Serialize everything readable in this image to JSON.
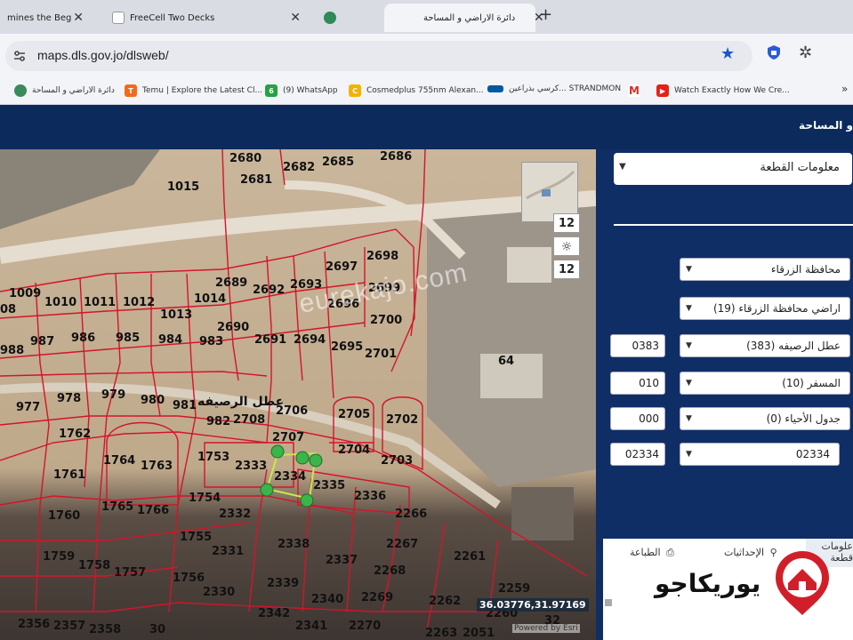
{
  "browser": {
    "tabs": [
      {
        "label": "mines the Beginn...",
        "active": false
      },
      {
        "label": "FreeCell Two Decks",
        "active": false
      },
      {
        "label": "",
        "active": false
      },
      {
        "label": "دائرة الاراضي و المساحة",
        "active": true
      }
    ],
    "new_tab": "+",
    "url": "maps.dls.gov.jo/dlsweb/",
    "bookmarks": [
      {
        "label": "دائرة الاراضي و المساحة",
        "icon": "dls-icon"
      },
      {
        "label": "Temu | Explore the Latest Cl...",
        "icon": "temu-icon"
      },
      {
        "label": "(9) WhatsApp",
        "icon": "whatsapp-icon"
      },
      {
        "label": "Cosmedplus 755nm Alexan...",
        "icon": "cosmed-icon"
      },
      {
        "label": "كرسي بذراعين... STRANDMON",
        "icon": "ikea-icon"
      },
      {
        "label": "",
        "icon": "gmail-icon"
      },
      {
        "label": "Watch Exactly How We Cre...",
        "icon": "youtube-icon"
      }
    ],
    "more": "»"
  },
  "app": {
    "title": "و المساحة"
  },
  "map": {
    "watermark": "eurekajo.com",
    "coords": "36.03776,31.97169",
    "attribution": "Powered by Esri",
    "overview_zoom_top": "12",
    "overview_zoom_bottom": "12",
    "area_label": "عطل الرصيفه",
    "parcels": [
      {
        "id": "2680"
      },
      {
        "id": "2682"
      },
      {
        "id": "2685"
      },
      {
        "id": "2686"
      },
      {
        "id": "2681"
      },
      {
        "id": "1015"
      },
      {
        "id": "2698"
      },
      {
        "id": "2697"
      },
      {
        "id": "2699"
      },
      {
        "id": "2689"
      },
      {
        "id": "2692"
      },
      {
        "id": "2693"
      },
      {
        "id": "2696"
      },
      {
        "id": "1009"
      },
      {
        "id": "1010"
      },
      {
        "id": "1011"
      },
      {
        "id": "1012"
      },
      {
        "id": "1014"
      },
      {
        "id": "1013"
      },
      {
        "id": "2690"
      },
      {
        "id": "2700"
      },
      {
        "id": "987"
      },
      {
        "id": "986"
      },
      {
        "id": "985"
      },
      {
        "id": "984"
      },
      {
        "id": "983"
      },
      {
        "id": "2691"
      },
      {
        "id": "2694"
      },
      {
        "id": "2695"
      },
      {
        "id": "2701"
      },
      {
        "id": "988"
      },
      {
        "id": "08"
      },
      {
        "id": "64"
      },
      {
        "id": "979"
      },
      {
        "id": "978"
      },
      {
        "id": "980"
      },
      {
        "id": "981"
      },
      {
        "id": "977"
      },
      {
        "id": "982"
      },
      {
        "id": "2708"
      },
      {
        "id": "2706"
      },
      {
        "id": "2705"
      },
      {
        "id": "2702"
      },
      {
        "id": "1762"
      },
      {
        "id": "2707"
      },
      {
        "id": "2704"
      },
      {
        "id": "1764"
      },
      {
        "id": "1763"
      },
      {
        "id": "1753"
      },
      {
        "id": "2333"
      },
      {
        "id": "2703"
      },
      {
        "id": "1761"
      },
      {
        "id": "2334"
      },
      {
        "id": "2335"
      },
      {
        "id": "1754"
      },
      {
        "id": "2336"
      },
      {
        "id": "1765"
      },
      {
        "id": "1766"
      },
      {
        "id": "2332"
      },
      {
        "id": "1760"
      },
      {
        "id": "2266"
      },
      {
        "id": "1755"
      },
      {
        "id": "2338"
      },
      {
        "id": "2267"
      },
      {
        "id": "2331"
      },
      {
        "id": "1759"
      },
      {
        "id": "2337"
      },
      {
        "id": "2261"
      },
      {
        "id": "1758"
      },
      {
        "id": "1757"
      },
      {
        "id": "2268"
      },
      {
        "id": "1756"
      },
      {
        "id": "2339"
      },
      {
        "id": "2330"
      },
      {
        "id": "2259"
      },
      {
        "id": "2340"
      },
      {
        "id": "2269"
      },
      {
        "id": "2262"
      },
      {
        "id": "2260"
      },
      {
        "id": "2342"
      },
      {
        "id": "2356"
      },
      {
        "id": "2357"
      },
      {
        "id": "2358"
      },
      {
        "id": "2341"
      },
      {
        "id": "2270"
      },
      {
        "id": "2263"
      },
      {
        "id": "2051"
      },
      {
        "id": "32"
      },
      {
        "id": "30"
      }
    ]
  },
  "panel": {
    "header": "معلومات القطعة",
    "fields": [
      {
        "value": "محافظة الزرقاء",
        "code": ""
      },
      {
        "value": "اراضي محافظة الزرقاء (19)",
        "code": ""
      },
      {
        "value": "عطل الرصيفه (383)",
        "code": "0383"
      },
      {
        "value": "المسفر (10)",
        "code": "010"
      },
      {
        "value": "جدول الأحياء (0)",
        "code": "000"
      },
      {
        "value": "02334",
        "code": "02334"
      }
    ],
    "tabs": {
      "info": "علومات",
      "info2": "قطعة",
      "coordinates": "الإحداثيات",
      "print": "الطباعة"
    }
  },
  "brand": {
    "logo_text": "يوريكاجو"
  },
  "colors": {
    "header_bg": "#0c2a5c",
    "panel_bg": "#0f2e66",
    "parcel_line": "#d4142a",
    "selected_line": "#c8e84a",
    "logo_red": "#d11f2a"
  }
}
